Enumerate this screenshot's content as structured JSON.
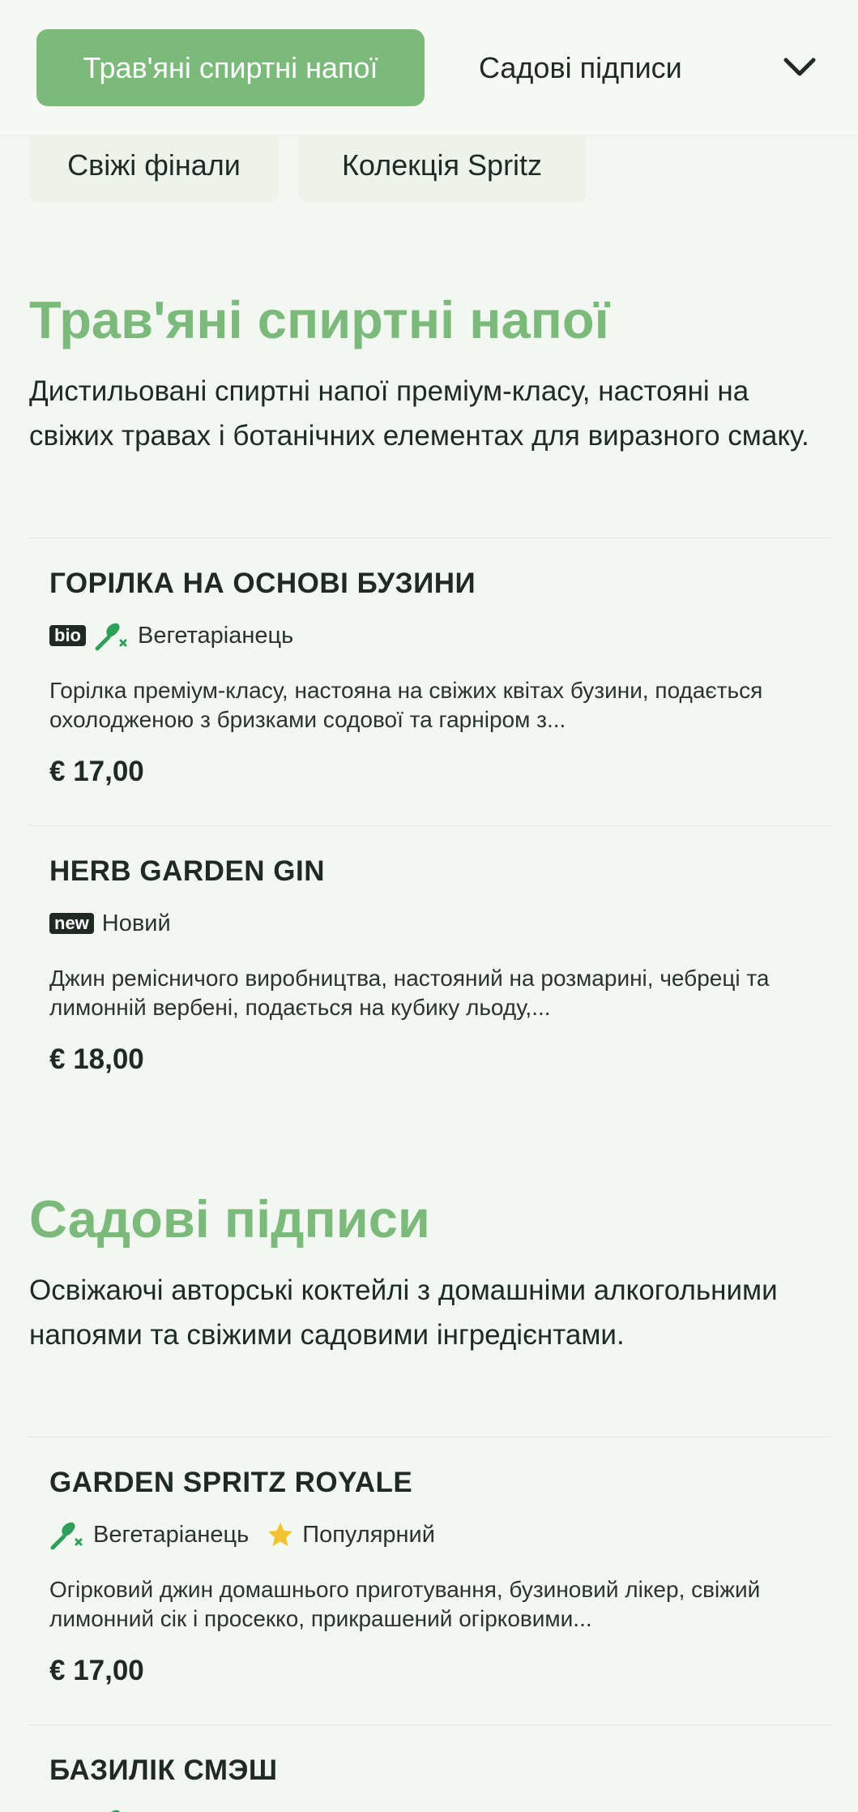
{
  "nav": {
    "categories": [
      {
        "label": "Трав'яні спиртні напої",
        "active": true
      },
      {
        "label": "Садові підписи",
        "active": false
      },
      {
        "label": "Свіжі фінали",
        "active": false
      },
      {
        "label": "Колекція Spritz",
        "active": false
      }
    ],
    "expand_icon": "chevron-down-icon"
  },
  "colors": {
    "accent": "#7cba7c",
    "background": "#f3f7f1",
    "text": "#1f2a22",
    "leaf_icon": "#2fa05a",
    "star_icon": "#f2c230"
  },
  "sections": [
    {
      "title": "Трав'яні спиртні напої",
      "description": "Дистильовані спиртні напої преміум-класу, настояні на свіжих травах і ботанічних елементах для виразного смаку.",
      "items": [
        {
          "name": "ГОРІЛКА НА ОСНОВІ БУЗИНИ",
          "badge": "bio",
          "tags": [
            {
              "icon": "vegetarian-leaf-icon",
              "label": "Вегетаріанець"
            }
          ],
          "description": "Горілка преміум-класу, настояна на свіжих квітах бузини, подається охолодженою з бризками содової та гарніром з...",
          "price": "€ 17,00"
        },
        {
          "name": "HERB GARDEN GIN",
          "badge": "new",
          "tags": [
            {
              "icon": "",
              "label": "Новий"
            }
          ],
          "description": "Джин ремісничого виробництва, настояний на розмарині, чебреці та лимонній вербені, подається на кубику льоду,...",
          "price": "€ 18,00"
        }
      ]
    },
    {
      "title": "Садові підписи",
      "description": "Освіжаючі авторські коктейлі з домашніми алкогольними напоями та свіжими садовими інгредієнтами.",
      "items": [
        {
          "name": "GARDEN SPRITZ ROYALE",
          "badge": "",
          "tags": [
            {
              "icon": "vegetarian-leaf-icon",
              "label": "Вегетаріанець"
            },
            {
              "icon": "star-icon",
              "label": "Популярний"
            }
          ],
          "description": "Огірковий джин домашнього приготування, бузиновий лікер, свіжий лимонний сік і просекко, прикрашений огірковими...",
          "price": "€ 17,00"
        },
        {
          "name": "БАЗИЛІК СМЭШ",
          "badge": "",
          "tags": [],
          "description": "",
          "price": ""
        }
      ]
    }
  ]
}
